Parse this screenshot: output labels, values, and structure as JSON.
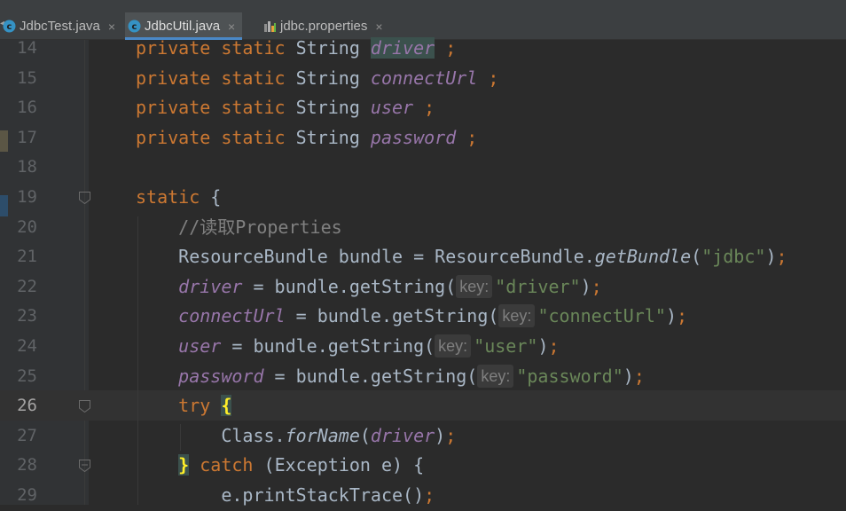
{
  "tabs": [
    {
      "label": "JdbcTest.java",
      "icon": "java-class-icon",
      "active": false
    },
    {
      "label": "JdbcUtil.java",
      "icon": "java-class-icon",
      "active": true
    },
    {
      "label": "jdbc.properties",
      "icon": "properties-file-icon",
      "active": false
    }
  ],
  "close_glyph": "×",
  "lines": [
    {
      "n": "14",
      "tokens": [
        [
          "kw",
          "private"
        ],
        [
          "p",
          " "
        ],
        [
          "kw",
          "static"
        ],
        [
          "p",
          " String "
        ],
        [
          "fldhl",
          "driver"
        ],
        [
          "p",
          " "
        ],
        [
          "kw",
          ";"
        ]
      ]
    },
    {
      "n": "15",
      "tokens": [
        [
          "kw",
          "private"
        ],
        [
          "p",
          " "
        ],
        [
          "kw",
          "static"
        ],
        [
          "p",
          " String "
        ],
        [
          "fld",
          "connectUrl"
        ],
        [
          "p",
          " "
        ],
        [
          "kw",
          ";"
        ]
      ]
    },
    {
      "n": "16",
      "tokens": [
        [
          "kw",
          "private"
        ],
        [
          "p",
          " "
        ],
        [
          "kw",
          "static"
        ],
        [
          "p",
          " String "
        ],
        [
          "fld",
          "user"
        ],
        [
          "p",
          " "
        ],
        [
          "kw",
          ";"
        ]
      ]
    },
    {
      "n": "17",
      "tokens": [
        [
          "kw",
          "private"
        ],
        [
          "p",
          " "
        ],
        [
          "kw",
          "static"
        ],
        [
          "p",
          " String "
        ],
        [
          "fld",
          "password"
        ],
        [
          "p",
          " "
        ],
        [
          "kw",
          ";"
        ]
      ]
    },
    {
      "n": "18",
      "tokens": []
    },
    {
      "n": "19",
      "tokens": [
        [
          "kw",
          "static"
        ],
        [
          "p",
          " {"
        ]
      ]
    },
    {
      "n": "20",
      "tokens": [
        [
          "p",
          "    "
        ],
        [
          "cm",
          "//读取Properties"
        ]
      ]
    },
    {
      "n": "21",
      "tokens": [
        [
          "p",
          "    ResourceBundle bundle = ResourceBundle."
        ],
        [
          "it",
          "getBundle"
        ],
        [
          "p",
          "("
        ],
        [
          "str",
          "\"jdbc\""
        ],
        [
          "p",
          ")"
        ],
        [
          "kw",
          ";"
        ]
      ]
    },
    {
      "n": "22",
      "tokens": [
        [
          "p",
          "    "
        ],
        [
          "fld",
          "driver"
        ],
        [
          "p",
          " = bundle.getString("
        ],
        [
          "hint",
          "key:"
        ],
        [
          "str",
          "\"driver\""
        ],
        [
          "p",
          ")"
        ],
        [
          "kw",
          ";"
        ]
      ]
    },
    {
      "n": "23",
      "tokens": [
        [
          "p",
          "    "
        ],
        [
          "fld",
          "connectUrl"
        ],
        [
          "p",
          " = bundle.getString("
        ],
        [
          "hint",
          "key:"
        ],
        [
          "str",
          "\"connectUrl\""
        ],
        [
          "p",
          ")"
        ],
        [
          "kw",
          ";"
        ]
      ]
    },
    {
      "n": "24",
      "tokens": [
        [
          "p",
          "    "
        ],
        [
          "fld",
          "user"
        ],
        [
          "p",
          " = bundle.getString("
        ],
        [
          "hint",
          "key:"
        ],
        [
          "str",
          "\"user\""
        ],
        [
          "p",
          ")"
        ],
        [
          "kw",
          ";"
        ]
      ]
    },
    {
      "n": "25",
      "tokens": [
        [
          "p",
          "    "
        ],
        [
          "fld",
          "password"
        ],
        [
          "p",
          " = bundle.getString("
        ],
        [
          "hint",
          "key:"
        ],
        [
          "str",
          "\"password\""
        ],
        [
          "p",
          ")"
        ],
        [
          "kw",
          ";"
        ]
      ]
    },
    {
      "n": "26",
      "tokens": [
        [
          "p",
          "    "
        ],
        [
          "kw",
          "try"
        ],
        [
          "p",
          " "
        ],
        [
          "bracehl",
          "{"
        ]
      ]
    },
    {
      "n": "27",
      "tokens": [
        [
          "p",
          "        Class."
        ],
        [
          "it",
          "forName"
        ],
        [
          "p",
          "("
        ],
        [
          "fld",
          "driver"
        ],
        [
          "p",
          ")"
        ],
        [
          "kw",
          ";"
        ]
      ]
    },
    {
      "n": "28",
      "tokens": [
        [
          "p",
          "    "
        ],
        [
          "bracehl",
          "}"
        ],
        [
          "p",
          " "
        ],
        [
          "kw",
          "catch"
        ],
        [
          "p",
          " (Exception e) {"
        ]
      ]
    },
    {
      "n": "29",
      "tokens": [
        [
          "p",
          "        e.printStackTrace()"
        ],
        [
          "kw",
          ";"
        ]
      ]
    }
  ],
  "colors": {
    "background": "#2b2b2b",
    "gutter": "#313335",
    "keyword": "#cc7832",
    "field": "#9876aa",
    "string": "#6a8759",
    "comment": "#808080",
    "text": "#a9b7c6",
    "tab_accent": "#4a88c7"
  }
}
